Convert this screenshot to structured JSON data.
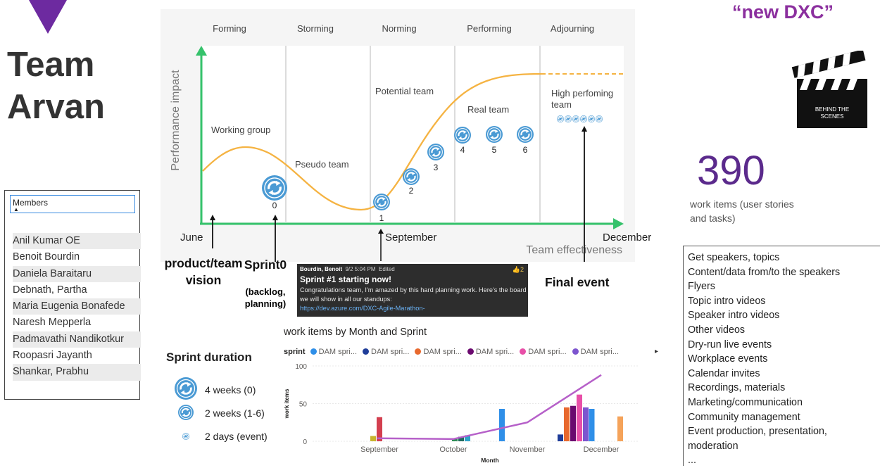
{
  "branding": {
    "team_title_line1": "Team",
    "team_title_line2": "Arvan",
    "tagline": "“new DXC”",
    "clapper_line1": "BEHIND THE",
    "clapper_line2": "SCENES"
  },
  "stats": {
    "count": "390",
    "caption": "work items (user stories and tasks)"
  },
  "members": {
    "header": "Members",
    "list": [
      "Anil Kumar OE",
      "Benoit Bourdin",
      "Daniela Baraitaru",
      "Debnath, Partha",
      "Maria Eugenia Bonafede",
      "Naresh Mepperla",
      "Padmavathi Nandikotkur",
      "Roopasri Jayanth",
      "Shankar, Prabhu"
    ]
  },
  "team_model": {
    "stages": [
      "Forming",
      "Storming",
      "Norming",
      "Performing",
      "Adjourning"
    ],
    "y_axis": "Performance impact",
    "x_axis": "Team effectiveness",
    "curve_labels": [
      "Working group",
      "Pseudo team",
      "Potential team",
      "Real team",
      "High perfoming team"
    ],
    "sprint_numbers": [
      "0",
      "1",
      "2",
      "3",
      "4",
      "5",
      "6"
    ],
    "months": [
      "June",
      "September",
      "December"
    ],
    "colors": {
      "curve": "#f5b342",
      "axis": "#35c26b",
      "sprint": "#4a9ad4"
    }
  },
  "annotations": {
    "vision": "product/team vision",
    "sprint0": "Sprint0",
    "sprint0_sub": "(backlog, planning)",
    "final_event": "Final event"
  },
  "chat": {
    "author": "Bourdin, Benoit",
    "time": "9/2 5:04 PM",
    "edited": "Edited",
    "likes": "👍2",
    "title": "Sprint #1 starting now!",
    "body": "Congratulations team, I'm amazed by this hard planning work. Here's the board we will show in all our standups:",
    "link": "https://dev.azure.com/DXC-Agile-Marathon-"
  },
  "sprint_duration": {
    "title": "Sprint duration",
    "items": [
      "4 weeks (0)",
      "2 weeks (1-6)",
      "2 days (event)"
    ]
  },
  "checklist": [
    "Get speakers, topics",
    "Content/data from/to the speakers",
    "Flyers",
    "Topic intro videos",
    "Speaker intro videos",
    "Other videos",
    "Dry-run live events",
    "Workplace events",
    "Calendar invites",
    "Recordings, materials",
    "Marketing/communication",
    "Community management",
    "Event production, presentation,",
    "moderation",
    "..."
  ],
  "work_items_chart": {
    "title": "work items by Month and Sprint",
    "legend_title": "sprint",
    "legend": [
      {
        "label": "DAM spri...",
        "color": "#2f8fe8"
      },
      {
        "label": "DAM spri...",
        "color": "#1f3d99"
      },
      {
        "label": "DAM spri...",
        "color": "#e8692e"
      },
      {
        "label": "DAM spri...",
        "color": "#6b0a6f"
      },
      {
        "label": "DAM spri...",
        "color": "#e84fa8"
      },
      {
        "label": "DAM spri...",
        "color": "#7d55cf"
      }
    ],
    "legend_more": "▸"
  },
  "chart_data": {
    "type": "bar",
    "title": "work items by Month and Sprint",
    "xlabel": "Month",
    "ylabel": "work items",
    "categories": [
      "September",
      "October",
      "November",
      "December"
    ],
    "yticks": [
      0,
      50,
      100
    ],
    "ylim": [
      0,
      100
    ],
    "grid": true,
    "bars": [
      {
        "month": "September",
        "value": 7,
        "color": "#c8b42e"
      },
      {
        "month": "September",
        "value": 32,
        "color": "#d33f4f"
      },
      {
        "month": "October",
        "value": 4,
        "color": "#2f8a57"
      },
      {
        "month": "October",
        "value": 6,
        "color": "#1f6b5d"
      },
      {
        "month": "October",
        "value": 8,
        "color": "#2fa3c8"
      },
      {
        "month": "October",
        "value": 43,
        "color": "#2f8fe8"
      },
      {
        "month": "November",
        "value": 43,
        "color": "#2f8fe8"
      },
      {
        "month": "December",
        "value": 9,
        "color": "#1f3d99"
      },
      {
        "month": "December",
        "value": 45,
        "color": "#e8692e"
      },
      {
        "month": "December",
        "value": 47,
        "color": "#6b0a6f"
      },
      {
        "month": "December",
        "value": 62,
        "color": "#e84fa8"
      },
      {
        "month": "December",
        "value": 45,
        "color": "#7d55cf"
      },
      {
        "month": "December",
        "value": 33,
        "color": "#f5a35a"
      }
    ],
    "line": {
      "color": "#b660c9",
      "points": [
        {
          "x": "September",
          "y": 4
        },
        {
          "x": "October",
          "y": 3
        },
        {
          "x": "November",
          "y": 25
        },
        {
          "x": "December",
          "y": 88
        }
      ]
    }
  }
}
